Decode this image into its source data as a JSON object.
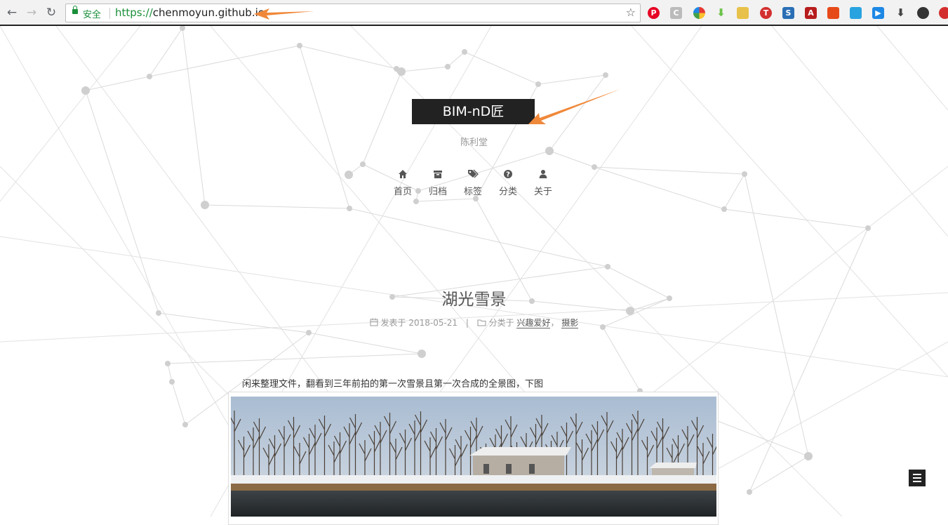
{
  "browser": {
    "secure_label": "安全",
    "url_protocol": "https://",
    "url_host": "chenmoyun.github.io",
    "extension_icons": [
      "pinterest-icon",
      "c-icon",
      "colors-icon",
      "download-green-icon",
      "cat-icon",
      "t-red-icon",
      "s-icon",
      "pdf-icon",
      "red-box-icon",
      "stripes-icon",
      "arrow-blue-icon",
      "download-icon",
      "circle-icon",
      "red-star-icon"
    ]
  },
  "site": {
    "brand": "BIM-nD匠",
    "subtitle": "陈利堂",
    "menu": [
      {
        "label": "首页",
        "icon": "home-icon"
      },
      {
        "label": "归档",
        "icon": "archive-icon"
      },
      {
        "label": "标签",
        "icon": "tags-icon"
      },
      {
        "label": "分类",
        "icon": "question-circle-icon"
      },
      {
        "label": "关于",
        "icon": "user-icon"
      }
    ]
  },
  "post": {
    "title": "湖光雪景",
    "posted_label": "发表于",
    "posted_date": "2018-05-21",
    "category_label": "分类于",
    "categories": [
      "兴趣爱好",
      "摄影"
    ],
    "category_separator": "，",
    "meta_divider": "|",
    "paragraph": "闲来整理文件，翻看到三年前拍的第一次雪景且第一次合成的全景图，下图"
  },
  "colors": {
    "accent_arrow": "#f0883a",
    "brand_bg": "#222222",
    "secure_green": "#1a8f3a"
  }
}
